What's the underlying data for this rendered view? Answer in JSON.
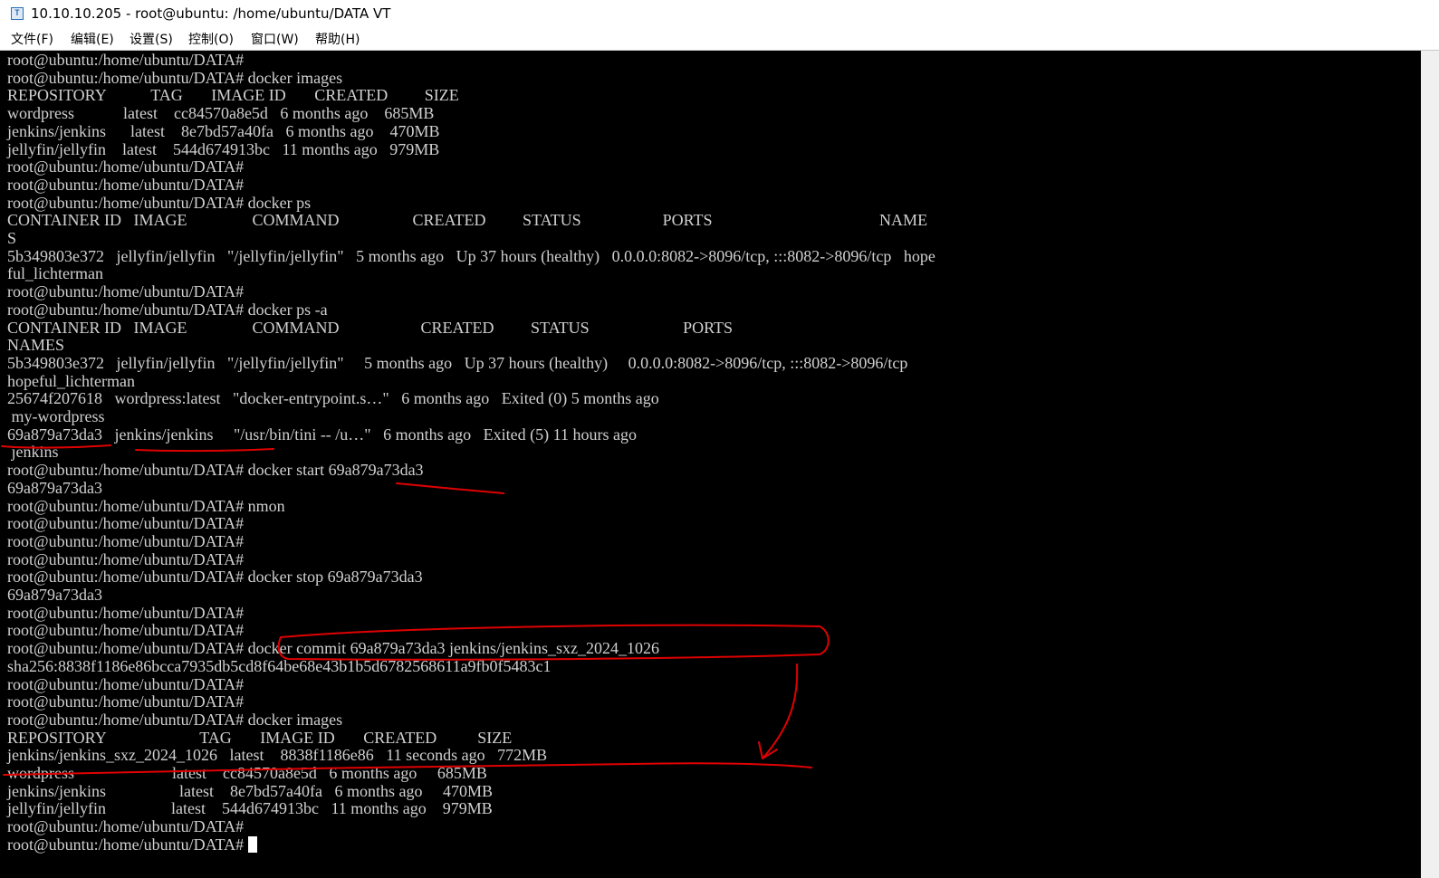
{
  "window": {
    "title": "10.10.10.205 - root@ubuntu: /home/ubuntu/DATA VT",
    "icon_name": "terminal-app-icon",
    "icon_glyph": "T"
  },
  "menu": [
    "文件(F)",
    "编辑(E)",
    "设置(S)",
    "控制(O)",
    "窗口(W)",
    "帮助(H)"
  ],
  "terminal": {
    "background": "#000000",
    "foreground": "#d0d0d0",
    "lines": [
      "root@ubuntu:/home/ubuntu/DATA#",
      "root@ubuntu:/home/ubuntu/DATA# docker images",
      "REPOSITORY           TAG       IMAGE ID       CREATED         SIZE",
      "wordpress            latest    cc84570a8e5d   6 months ago    685MB",
      "jenkins/jenkins      latest    8e7bd57a40fa   6 months ago    470MB",
      "jellyfin/jellyfin    latest    544d674913bc   11 months ago   979MB",
      "root@ubuntu:/home/ubuntu/DATA#",
      "root@ubuntu:/home/ubuntu/DATA#",
      "root@ubuntu:/home/ubuntu/DATA# docker ps",
      "CONTAINER ID   IMAGE                COMMAND                  CREATED         STATUS                    PORTS                                         NAME",
      "S",
      "5b349803e372   jellyfin/jellyfin   \"/jellyfin/jellyfin\"   5 months ago   Up 37 hours (healthy)   0.0.0.0:8082->8096/tcp, :::8082->8096/tcp   hope",
      "ful_lichterman",
      "root@ubuntu:/home/ubuntu/DATA#",
      "root@ubuntu:/home/ubuntu/DATA# docker ps -a",
      "CONTAINER ID   IMAGE                COMMAND                    CREATED         STATUS                       PORTS",
      "NAMES",
      "5b349803e372   jellyfin/jellyfin   \"/jellyfin/jellyfin\"     5 months ago   Up 37 hours (healthy)     0.0.0.0:8082->8096/tcp, :::8082->8096/tcp",
      "hopeful_lichterman",
      "25674f207618   wordpress:latest   \"docker-entrypoint.s…\"   6 months ago   Exited (0) 5 months ago",
      " my-wordpress",
      "69a879a73da3   jenkins/jenkins     \"/usr/bin/tini -- /u…\"   6 months ago   Exited (5) 11 hours ago",
      " jenkins",
      "root@ubuntu:/home/ubuntu/DATA# docker start 69a879a73da3",
      "69a879a73da3",
      "root@ubuntu:/home/ubuntu/DATA# nmon",
      "root@ubuntu:/home/ubuntu/DATA#",
      "root@ubuntu:/home/ubuntu/DATA#",
      "root@ubuntu:/home/ubuntu/DATA#",
      "root@ubuntu:/home/ubuntu/DATA# docker stop 69a879a73da3",
      "69a879a73da3",
      "root@ubuntu:/home/ubuntu/DATA#",
      "root@ubuntu:/home/ubuntu/DATA#",
      "root@ubuntu:/home/ubuntu/DATA# docker commit 69a879a73da3 jenkins/jenkins_sxz_2024_1026",
      "sha256:8838f1186e86bcca7935db5cd8f64be68e43b1b5d6782568611a9fb0f5483c1",
      "root@ubuntu:/home/ubuntu/DATA#",
      "root@ubuntu:/home/ubuntu/DATA#",
      "root@ubuntu:/home/ubuntu/DATA# docker images",
      "REPOSITORY                       TAG       IMAGE ID       CREATED          SIZE",
      "jenkins/jenkins_sxz_2024_1026   latest    8838f1186e86   11 seconds ago   772MB",
      "wordpress                        latest    cc84570a8e5d   6 months ago     685MB",
      "jenkins/jenkins                  latest    8e7bd57a40fa   6 months ago     470MB",
      "jellyfin/jellyfin                latest    544d674913bc   11 months ago    979MB",
      "root@ubuntu:/home/ubuntu/DATA#",
      "root@ubuntu:/home/ubuntu/DATA# "
    ]
  },
  "annotation": {
    "color": "#e00000",
    "marks": [
      "underline-container-id",
      "underline-image-name",
      "underline-start-id",
      "circle-commit-command",
      "arrow-to-new-image",
      "underline-new-image-row"
    ]
  }
}
